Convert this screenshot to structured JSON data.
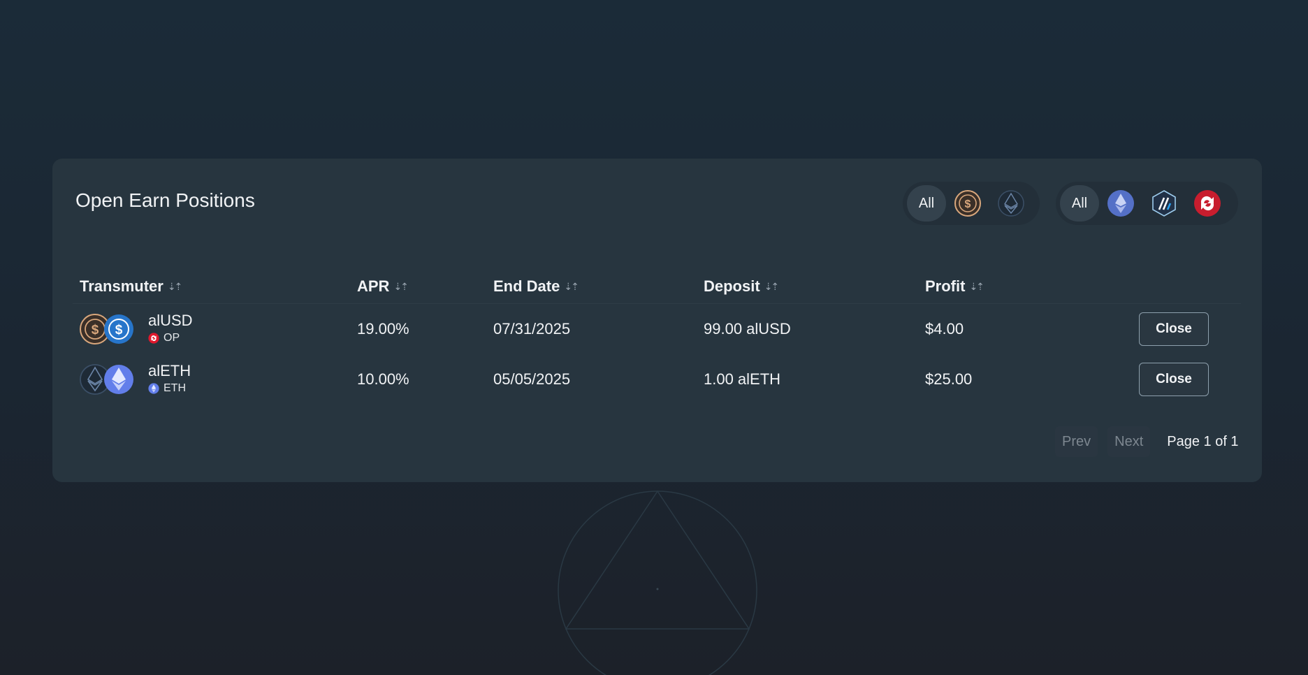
{
  "card": {
    "title": "Open Earn Positions"
  },
  "filters": {
    "token_filter": {
      "all_label": "All",
      "options": [
        "alusd-icon",
        "aleth-icon"
      ]
    },
    "network_filter": {
      "all_label": "All",
      "options": [
        "ethereum-icon",
        "arbitrum-icon",
        "optimism-icon"
      ]
    }
  },
  "table": {
    "columns": [
      "Transmuter",
      "APR",
      "End Date",
      "Deposit",
      "Profit"
    ],
    "sort_icon": "⇣⇡",
    "rows": [
      {
        "token": "alUSD",
        "network": "OP",
        "apr": "19.00%",
        "end_date": "07/31/2025",
        "deposit": "99.00 alUSD",
        "profit": "$4.00",
        "action": "Close"
      },
      {
        "token": "alETH",
        "network": "ETH",
        "apr": "10.00%",
        "end_date": "05/05/2025",
        "deposit": "1.00 alETH",
        "profit": "$25.00",
        "action": "Close"
      }
    ]
  },
  "pagination": {
    "prev": "Prev",
    "next": "Next",
    "info": "Page 1 of 1"
  },
  "colors": {
    "background": "#1b2b38",
    "card": "#27353f",
    "usdc_blue": "#2775ca",
    "eth_purple": "#627eea",
    "optimism_red": "#e0182d",
    "alusd_bronze": "#d9a77c"
  }
}
